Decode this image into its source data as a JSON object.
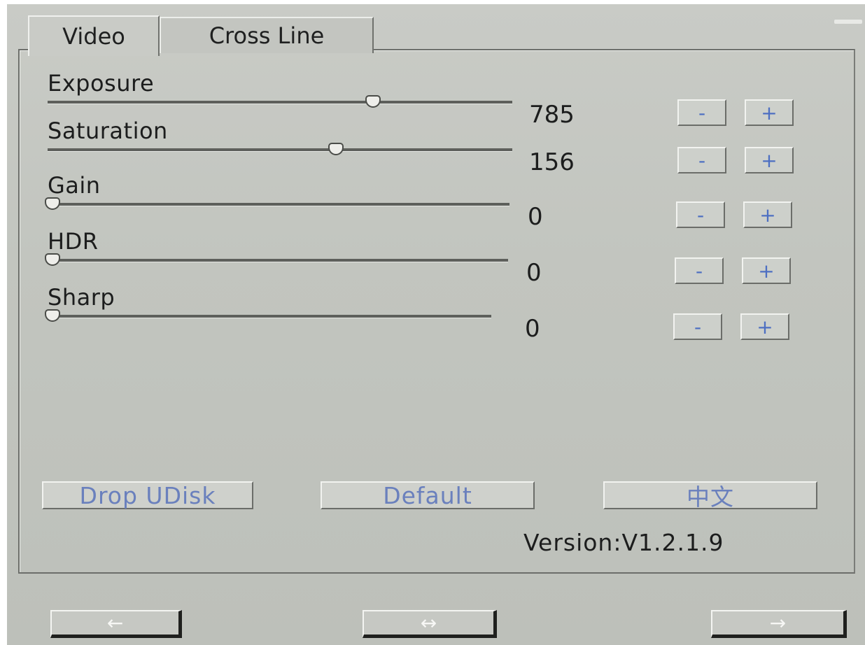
{
  "tabs": {
    "video": "Video",
    "cross_line": "Cross Line"
  },
  "params": [
    {
      "label": "Exposure",
      "value": "785",
      "level": 0.69
    },
    {
      "label": "Saturation",
      "value": "156",
      "level": 0.61
    },
    {
      "label": "Gain",
      "value": "0",
      "level": 0.0
    },
    {
      "label": "HDR",
      "value": "0",
      "level": 0.0
    },
    {
      "label": "Sharp",
      "value": "0",
      "level": 0.0
    }
  ],
  "step": {
    "minus": "-",
    "plus": "+"
  },
  "buttons": {
    "drop_udisk": "Drop UDisk",
    "default": "Default",
    "language": "中文"
  },
  "version": "Version:V1.2.1.9",
  "nav": {
    "back": "←",
    "center": "↔",
    "forward": "→"
  },
  "colors": {
    "accent_text": "#4d6fc2",
    "panel_bg": "#c5c7c2"
  }
}
